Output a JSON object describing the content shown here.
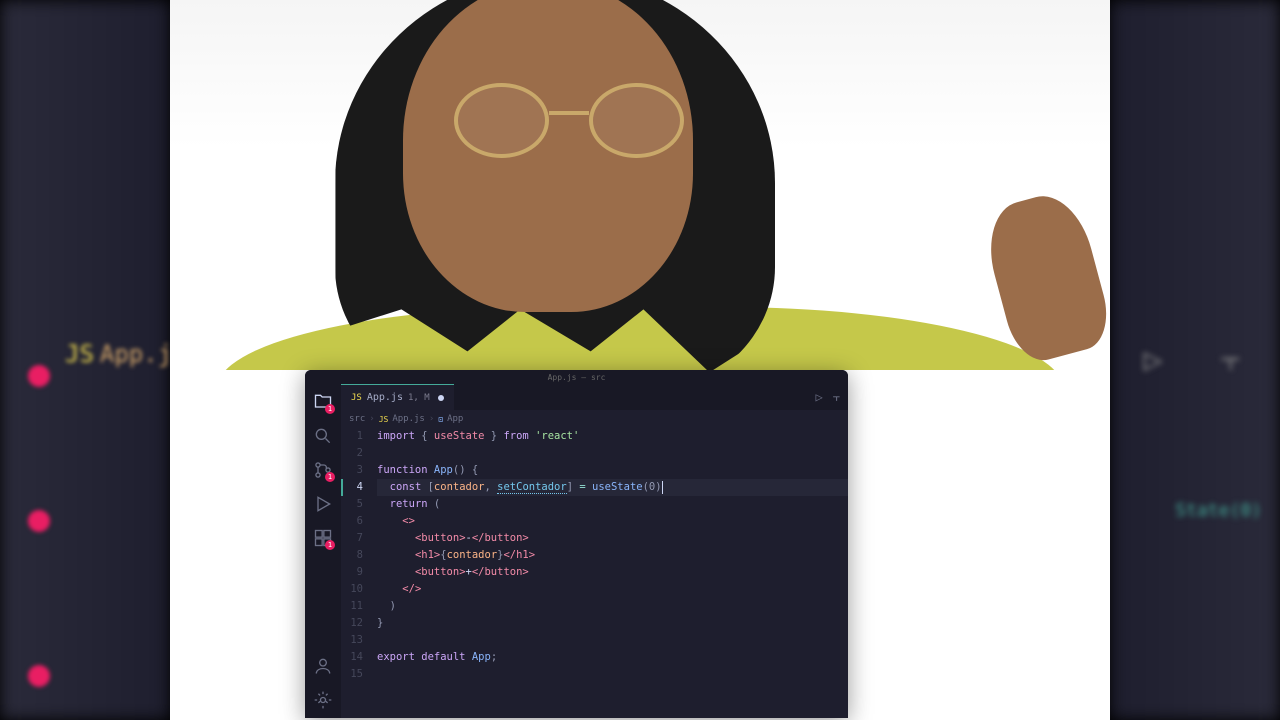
{
  "bg": {
    "tab_left": "App.j",
    "text_right": "State(0)"
  },
  "editor": {
    "title": "App.js — src",
    "tab": {
      "filename": "App.js",
      "modified_badge": "1, M"
    },
    "actions": {
      "run": "▷",
      "split": "⫟"
    },
    "breadcrumb": {
      "folder": "src",
      "file": "App.js",
      "symbol": "App"
    },
    "activity": {
      "explorer_badge": "1",
      "scm_badge": "1",
      "ext_badge": "1"
    },
    "code": {
      "l1_import": "import",
      "l1_brace_o": " { ",
      "l1_usestate": "useState",
      "l1_brace_c": " } ",
      "l1_from": "from",
      "l1_react": " 'react'",
      "l3_function": "function",
      "l3_app": " App",
      "l3_paren": "() {",
      "l4_const": "const",
      "l4_bracket_o": " [",
      "l4_contador": "contador",
      "l4_comma": ", ",
      "l4_setcontador": "setContador",
      "l4_bracket_c": "] ",
      "l4_eq": "= ",
      "l4_usestate": "useState",
      "l4_arg": "(0)",
      "l5_return": "return",
      "l5_paren": " (",
      "l6_frag_open": "<>",
      "l7_btn_open": "<button>",
      "l7_minus": "-",
      "l7_btn_close": "</button>",
      "l8_h1_open": "<h1>",
      "l8_brace_o": "{",
      "l8_contador": "contador",
      "l8_brace_c": "}",
      "l8_h1_close": "</h1>",
      "l9_btn_open": "<button>",
      "l9_plus": "+",
      "l9_btn_close": "</button>",
      "l10_frag_close": "</>",
      "l11_paren": ")",
      "l12_brace": "}",
      "l14_export": "export default",
      "l14_app": " App",
      "l14_semi": ";"
    },
    "line_numbers": [
      "1",
      "2",
      "3",
      "4",
      "5",
      "6",
      "7",
      "8",
      "9",
      "10",
      "11",
      "12",
      "13",
      "14",
      "15"
    ]
  }
}
